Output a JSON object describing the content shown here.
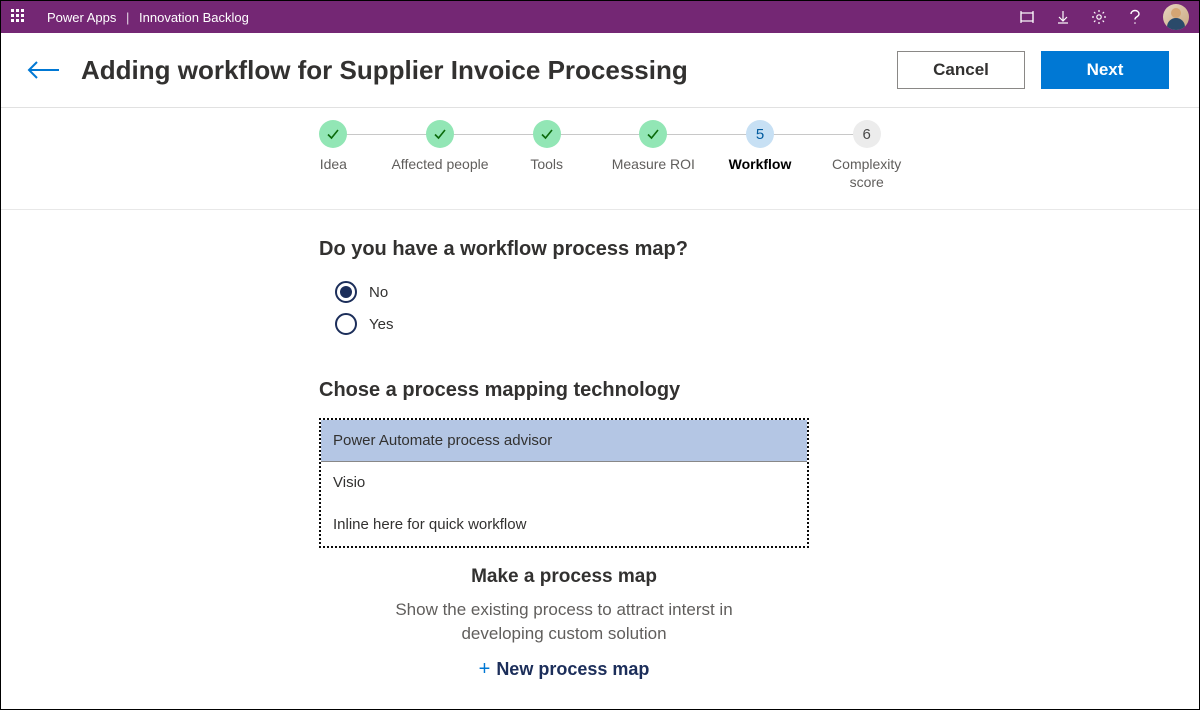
{
  "topbar": {
    "product": "Power Apps",
    "app_name": "Innovation Backlog"
  },
  "header": {
    "title": "Adding workflow for Supplier Invoice Processing",
    "cancel": "Cancel",
    "next": "Next"
  },
  "stepper": {
    "items": [
      {
        "label": "Idea",
        "state": "done"
      },
      {
        "label": "Affected people",
        "state": "done"
      },
      {
        "label": "Tools",
        "state": "done"
      },
      {
        "label": "Measure ROI",
        "state": "done"
      },
      {
        "label": "Workflow",
        "state": "current",
        "num": "5"
      },
      {
        "label": "Complexity score",
        "state": "future",
        "num": "6"
      }
    ]
  },
  "form": {
    "q1": "Do you have a workflow process map?",
    "opt_no": "No",
    "opt_yes": "Yes",
    "q2": "Chose a process mapping technology",
    "tech": [
      "Power Automate process advisor",
      "Visio",
      "Inline here for quick workflow"
    ],
    "make_heading": "Make a process map",
    "make_sub": "Show the existing process to attract interst in developing custom solution",
    "add_new": "New process map"
  }
}
